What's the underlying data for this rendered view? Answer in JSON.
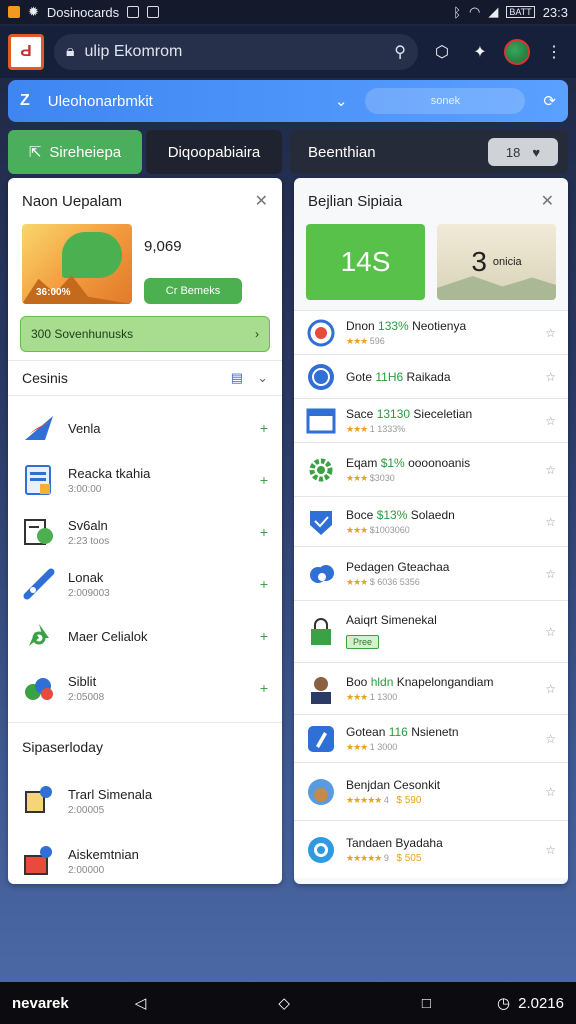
{
  "status": {
    "app_name": "Dosinocards",
    "time": "23:3",
    "battery": "BATT"
  },
  "browser": {
    "url": "ulip Ekomrom",
    "logo_text": "Ԁ"
  },
  "bluebar": {
    "title": "Uleohonarbmkit",
    "search_placeholder": "sonek"
  },
  "tabs": [
    {
      "label": "Sireheiepa"
    },
    {
      "label": "Diqoopabiaira"
    },
    {
      "label": "Beenthian"
    }
  ],
  "tab_pill": {
    "value": "18"
  },
  "left": {
    "title": "Naon Uepalam",
    "promo_caption": "36:00%",
    "promo_value": "9,069",
    "promo_button": "Cr Bemeks",
    "banner": "300 Sovenhunusks",
    "section_title": "Cesinis",
    "items": [
      {
        "label": "Venla",
        "sub": ""
      },
      {
        "label": "Reacka tkahia",
        "sub": "3:00:00"
      },
      {
        "label": "Sv6aln",
        "sub": "2:23 toos"
      },
      {
        "label": "Lonak",
        "sub": "2:009003"
      },
      {
        "label": "Maer Celialok",
        "sub": ""
      },
      {
        "label": "Siblit",
        "sub": "2:05008"
      }
    ],
    "section2_title": "Sipaserloday",
    "items2": [
      {
        "label": "Trarl Simenala",
        "sub": "2:00005"
      },
      {
        "label": "Aiskemtnian",
        "sub": "2:00000"
      }
    ]
  },
  "right": {
    "title": "Bejlian Sipiaia",
    "stat1": "14S",
    "stat2_num": "3",
    "stat2_text": "onicia",
    "items": [
      {
        "pre": "Dnon",
        "hl": "133%",
        "post": "Neotienya",
        "sub": "596"
      },
      {
        "pre": "Gote",
        "hl": "11H6",
        "post": "Raikada",
        "sub": ""
      },
      {
        "pre": "Sace",
        "hl": "13130",
        "post": "Sieceletian",
        "sub": "1 1333%"
      },
      {
        "pre": "Eqam",
        "hl": "$1%",
        "post": "oooonoanis",
        "sub": "$3030"
      },
      {
        "pre": "Boce",
        "hl": "$13%",
        "post": "Solaedn",
        "sub": "$1003060"
      },
      {
        "pre": "Pedagen",
        "hl": "",
        "post": "Gteachaa",
        "sub": "$ 6036 5356"
      },
      {
        "pre": "Aaiqrt",
        "hl": "",
        "post": "Simenekal",
        "sub": "",
        "tag": "Pree"
      },
      {
        "pre": "Boo",
        "hl": "hldn",
        "post": "Knapelongandiam",
        "sub": "1 1300"
      },
      {
        "pre": "Gotean",
        "hl": "116",
        "post": "Nsienetn",
        "sub": "1 3000"
      },
      {
        "pre": "Benjdan",
        "hl": "",
        "post": "Cesonkit",
        "sub": "",
        "rating": "4",
        "price": "$ 590"
      },
      {
        "pre": "Tandaen",
        "hl": "",
        "post": "Byadaha",
        "sub": "",
        "rating": "9",
        "price": "$ 505"
      }
    ]
  },
  "navbar": {
    "left_text": "nevarek",
    "right_text": "2.0216"
  }
}
